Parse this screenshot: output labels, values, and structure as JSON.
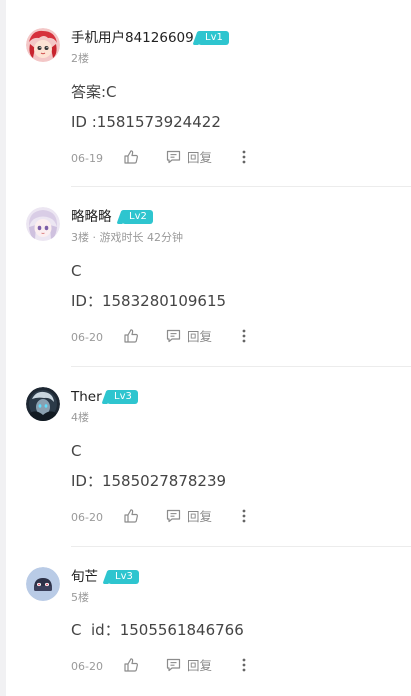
{
  "comments": [
    {
      "username": "手机用户84126609",
      "level": "Lv1",
      "meta": "2楼",
      "lines": [
        "答案:C",
        "ID :1581573924422"
      ],
      "date": "06-19",
      "reply_label": "回复"
    },
    {
      "username": "略略略",
      "level": "Lv2",
      "meta": "3楼 · 游戏时长 42分钟",
      "lines": [
        "C",
        "ID：1583280109615"
      ],
      "date": "06-20",
      "reply_label": "回复"
    },
    {
      "username": "Ther",
      "level": "Lv3",
      "meta": "4楼",
      "lines": [
        "C",
        "ID：1585027878239"
      ],
      "date": "06-20",
      "reply_label": "回复"
    },
    {
      "username": "旬芒",
      "level": "Lv3",
      "meta": "5楼",
      "lines": [
        "C  id：1505561846766"
      ],
      "date": "06-20",
      "reply_label": "回复"
    }
  ],
  "colors": {
    "level_badge": "#2ec5cf",
    "text_primary": "#222222",
    "text_secondary": "#9a9a9a",
    "divider": "#ececec"
  },
  "icons": [
    "thumbs-up-icon",
    "comment-icon",
    "more-vertical-icon"
  ]
}
